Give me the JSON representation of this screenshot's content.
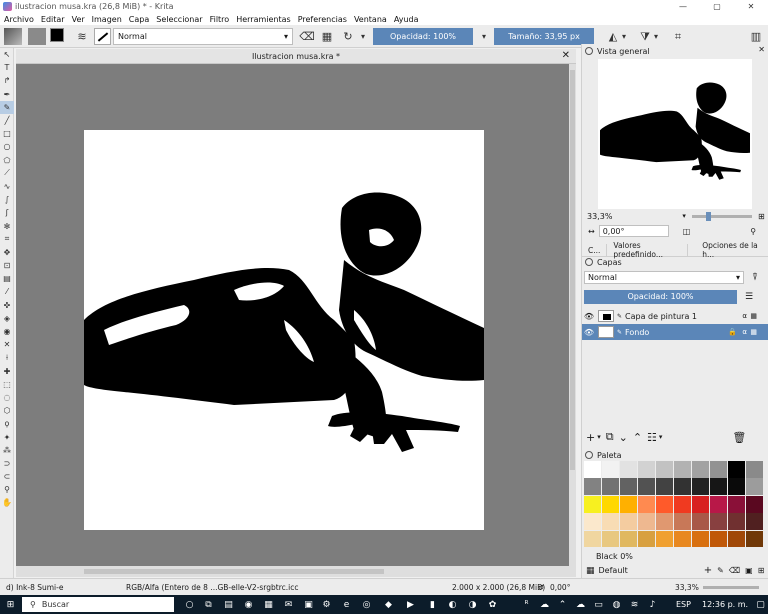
{
  "window": {
    "title": "ilustracion musa.kra (26,8 MiB)  * - Krita",
    "minimize": "—",
    "maximize": "▢",
    "close": "✕"
  },
  "menu": [
    "Archivo",
    "Editar",
    "Ver",
    "Imagen",
    "Capa",
    "Seleccionar",
    "Filtro",
    "Herramientas",
    "Preferencias",
    "Ventana",
    "Ayuda"
  ],
  "toolbar": {
    "blend_mode": "Normal",
    "opacity": "Opacidad: 100%",
    "size": "Tamaño: 33,95 px",
    "fg_color": "#000000",
    "bg_color": "#ffffff"
  },
  "document": {
    "tab_title": "Ilustracion musa.kra *",
    "close": "✕"
  },
  "overview": {
    "title": "Vista general",
    "zoom": "33,3%",
    "rotation": "0,00°"
  },
  "dock_tabs": [
    "C...",
    "Valores predefinido...",
    "Opciones de la h..."
  ],
  "layers": {
    "title": "Capas",
    "blend_mode": "Normal",
    "opacity": "Opacidad:  100%",
    "items": [
      {
        "name": "Capa de pintura 1",
        "selected": false
      },
      {
        "name": "Fondo",
        "selected": true
      }
    ]
  },
  "palette": {
    "title": "Paleta",
    "selected_color_name": "Black 0%",
    "set_name": "Default",
    "colors": [
      "#ffffff",
      "#f2f2f2",
      "#e2e2e2",
      "#d2d2d2",
      "#c2c2c2",
      "#b2b2b2",
      "#a2a2a2",
      "#929292",
      "#000000",
      "#8a8a8a",
      "#828282",
      "#727272",
      "#626262",
      "#525252",
      "#424242",
      "#323232",
      "#222222",
      "#161616",
      "#0a0a0a",
      "#9c9c9c",
      "#f7f020",
      "#ffd800",
      "#ffb000",
      "#ff8a50",
      "#ff5a2a",
      "#f03a20",
      "#d82020",
      "#b81848",
      "#8a1038",
      "#5a0820",
      "#fbe8cc",
      "#f8dcb4",
      "#f4cca0",
      "#eeb890",
      "#e09870",
      "#c87858",
      "#a85848",
      "#884040",
      "#703030",
      "#502020",
      "#f0d6a0",
      "#e8c880",
      "#e0b860",
      "#d8a040",
      "#f0a030",
      "#e88820",
      "#d87010",
      "#c05808",
      "#a04808",
      "#703808"
    ]
  },
  "status": {
    "brush": "d) Ink-8 Sumi-e",
    "color_profile": "RGB/Alfa (Entero de 8 ...GB-elle-V2-srgbtrc.icc",
    "image_size": "2.000 x 2.000 (26,8 MiB)",
    "rotation": "0,00°",
    "zoom": "33,3%"
  },
  "taskbar": {
    "search_placeholder": "Buscar",
    "language": "ESP",
    "time": "12:36 p. m."
  }
}
